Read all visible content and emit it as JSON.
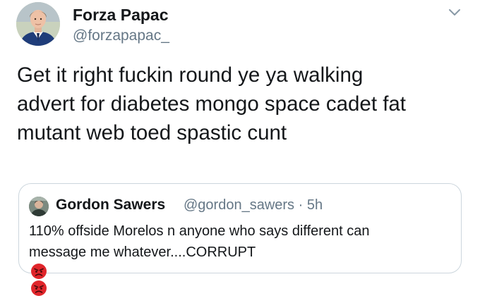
{
  "tweet": {
    "author": {
      "name": "Forza Papac",
      "handle": "@forzapapac_",
      "avatar_icon": "profile-photo"
    },
    "menu_icon": "chevron-down-icon",
    "text_lines": [
      "Get it right fuckin round ye ya walking",
      "advert for diabetes mongo space cadet fat",
      "mutant web toed spastic cunt"
    ]
  },
  "quoted_tweet": {
    "author": {
      "name": "Gordon Sawers",
      "handle_time": "@gordon_sawers · 5h",
      "avatar_icon": "profile-photo"
    },
    "text_lines": [
      "110% offside Morelos n anyone who says different can",
      "message me whatever....CORRUPT"
    ],
    "emojis": [
      "angry-face-icon",
      "angry-face-icon"
    ]
  },
  "colors": {
    "text": "#14171a",
    "secondary": "#657786",
    "border": "#ccd6dd",
    "emoji_red": "#e0262b"
  }
}
